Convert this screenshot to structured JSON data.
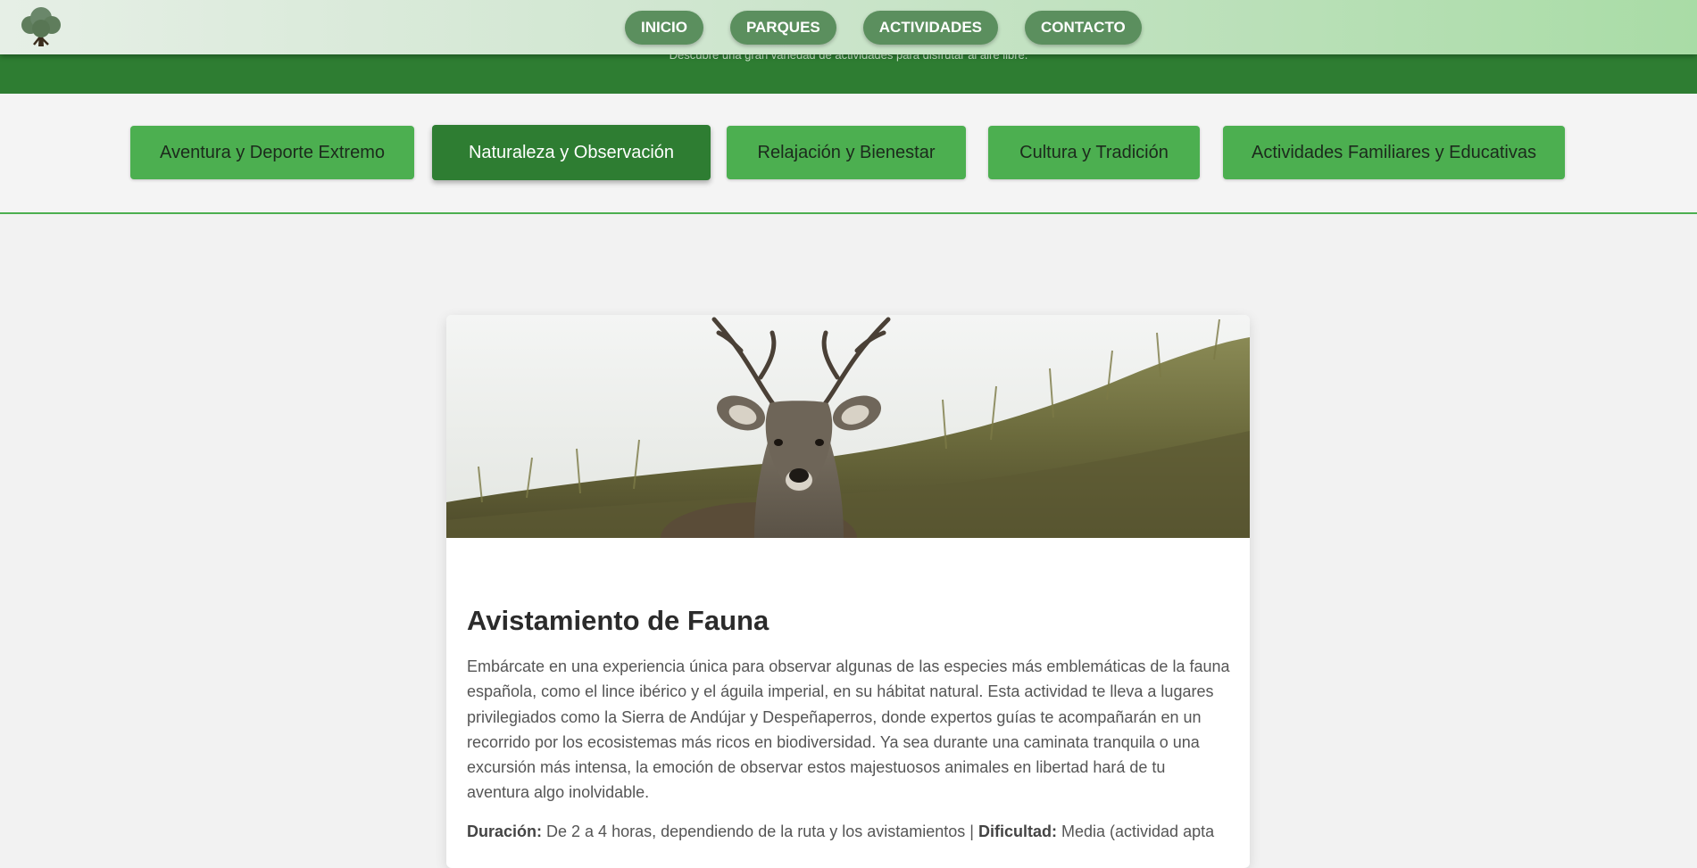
{
  "hero": {
    "subtitle": "Descubre una gran variedad de actividades para disfrutar al aire libre."
  },
  "nav": {
    "links": [
      "INICIO",
      "PARQUES",
      "ACTIVIDADES",
      "CONTACTO"
    ]
  },
  "categories": {
    "items": [
      "Aventura y Deporte Extremo",
      "Naturaleza y Observación",
      "Relajación y Bienestar",
      "Cultura y Tradición",
      "Actividades Familiares y Educativas"
    ],
    "active": "Naturaleza y Observación"
  },
  "card": {
    "image_subject": "deer-in-grassland",
    "title": "Avistamiento de Fauna",
    "description": "Embárcate en una experiencia única para observar algunas de las especies más emblemáticas de la fauna española, como el lince ibérico y el águila imperial, en su hábitat natural. Esta actividad te lleva a lugares privilegiados como la Sierra de Andújar y Despeñaperros, donde expertos guías te acompañarán en un recorrido por los ecosistemas más ricos en biodiversidad. Ya sea durante una caminata tranquila o una excursión más intensa, la emoción de observar estos majestuosos animales en libertad hará de tu aventura algo inolvidable.",
    "duration_label": "Duración:",
    "duration_value": " De 2 a 4 horas, dependiendo de la ruta y los avistamientos | ",
    "difficulty_label": "Dificultad:",
    "difficulty_value": " Media (actividad apta"
  },
  "colors": {
    "primary": "#4caf50",
    "primary_dark": "#2e7d32",
    "nav_pill": "#5b8f5e",
    "background": "#f2f2f2"
  }
}
